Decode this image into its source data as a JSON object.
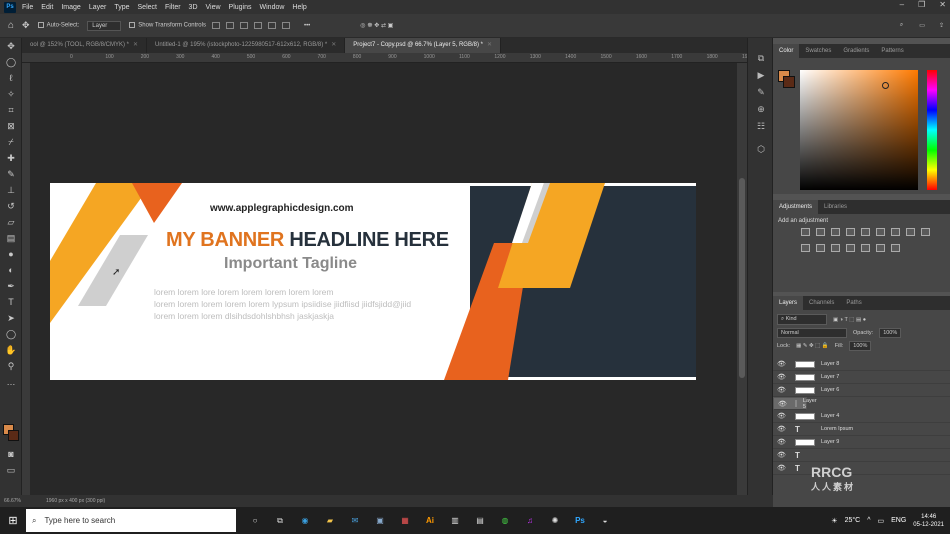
{
  "menu": [
    "File",
    "Edit",
    "Image",
    "Layer",
    "Type",
    "Select",
    "Filter",
    "3D",
    "View",
    "Plugins",
    "Window",
    "Help"
  ],
  "options": {
    "auto_select": "Auto-Select:",
    "layer_value": "Layer",
    "show_transform": "Show Transform Controls"
  },
  "tabs": [
    {
      "label": "ool @ 152% (TOOL, RGB/8/CMYK) *",
      "active": false
    },
    {
      "label": "Untitled-1 @ 195% (istockphoto-1225980517-612x612, RGB/8) *",
      "active": false
    },
    {
      "label": "Project7 - Copy.psd @ 66.7% (Layer 5, RGB/8) *",
      "active": true
    }
  ],
  "ruler_ticks": [
    "0",
    "100",
    "200",
    "300",
    "400",
    "500",
    "600",
    "700",
    "800",
    "900",
    "1000",
    "1100",
    "1200",
    "1300",
    "1400",
    "1500",
    "1600",
    "1700",
    "1800",
    "1900",
    "2000"
  ],
  "banner": {
    "url": "www.applegraphicdesign.com",
    "headline_part1": "MY BANNER",
    "headline_part2": "HEADLINE HERE",
    "tagline": "Important Tagline",
    "lorem_lines": [
      "lorem lorem lore lorem lorem lorem lorem lorem",
      "lorem lorem lorem lorem lorem lypsum ipsiidise jiidfiisd jiidfsjidd@jiid",
      "lorem lorem lorem dlsihdsdohlshbhsh jaskjaskja"
    ],
    "colors": {
      "orange": "#f5a623",
      "dark_orange": "#e8621e",
      "navy": "#26313c",
      "grey_band": "#cfcfcf"
    }
  },
  "status": {
    "zoom": "66.67%",
    "doc_size": "1960 px x 400 px (300 ppi)"
  },
  "panels": {
    "color_tabs": [
      "Color",
      "Swatches",
      "Gradients",
      "Patterns"
    ],
    "adj_tabs": [
      "Adjustments",
      "Libraries"
    ],
    "adj_label": "Add an adjustment",
    "layer_tabs": [
      "Layers",
      "Channels",
      "Paths"
    ],
    "kind": "Kind",
    "blend": "Normal",
    "opacity_label": "Opacity:",
    "opacity_value": "100%",
    "lock_label": "Lock:",
    "fill_label": "Fill:",
    "fill_value": "100%",
    "layers": [
      {
        "name": "Layer 8",
        "type": "pixel",
        "selected": false
      },
      {
        "name": "Layer 7",
        "type": "pixel",
        "selected": false
      },
      {
        "name": "Layer 6",
        "type": "pixel",
        "selected": false
      },
      {
        "name": "Layer 5",
        "type": "pixel",
        "selected": true
      },
      {
        "name": "Layer 4",
        "type": "pixel",
        "selected": false
      },
      {
        "name": "Lorem Ipsum",
        "type": "text",
        "selected": false
      },
      {
        "name": "Layer 9",
        "type": "pixel",
        "selected": false
      },
      {
        "name": "",
        "type": "text",
        "selected": false
      },
      {
        "name": "",
        "type": "text",
        "selected": false
      }
    ]
  },
  "taskbar": {
    "search_placeholder": "Type here to search",
    "weather": "25°C",
    "lang": "ENG",
    "time": "14:46",
    "date": "05-12-2021"
  },
  "watermark": {
    "main": "RRCG",
    "sub": "人人素材"
  }
}
